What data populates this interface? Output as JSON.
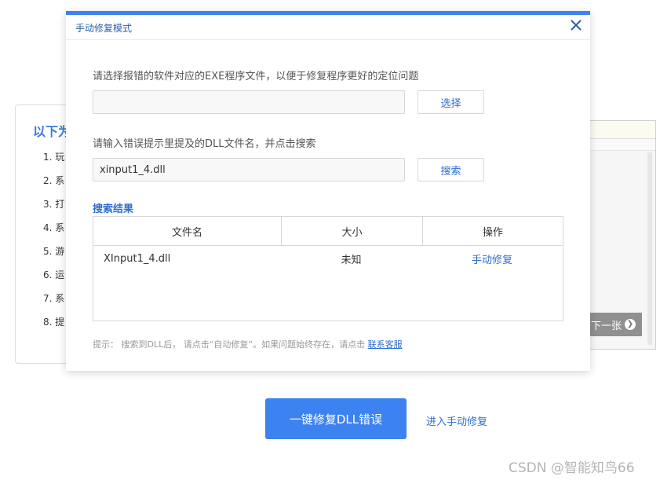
{
  "background": {
    "card_title": "以下为",
    "steps": [
      "1. 玩",
      "2. 系",
      "3. 打",
      "4. 系",
      "5. 游",
      "6. 运",
      "7. 系",
      "8. 提"
    ],
    "next_label": "下一张"
  },
  "modal": {
    "title": "手动修复模式",
    "exe_prompt": "请选择报错的软件对应的EXE程序文件，以便于修复程序更好的定位问题",
    "exe_value": "",
    "choose_label": "选择",
    "dll_prompt": "请输入错误提示里提及的DLL文件名，并点击搜索",
    "dll_value": "xinput1_4.dll",
    "search_label": "搜索",
    "results_title": "搜索结果",
    "table": {
      "headers": [
        "文件名",
        "大小",
        "操作"
      ],
      "rows": [
        {
          "name": "XInput1_4.dll",
          "size": "未知",
          "action": "手动修复"
        }
      ]
    },
    "hint_text": "提示： 搜索到DLL后， 请点击“自动修复”。如果问题始终存在，请点击",
    "hint_link": "联系客服"
  },
  "actions": {
    "one_click_fix": "一键修复DLL错误",
    "enter_manual": "进入手动修复"
  },
  "watermark": "CSDN @智能知鸟66",
  "colors": {
    "accent": "#3c82f0",
    "link": "#2f6dd0"
  }
}
